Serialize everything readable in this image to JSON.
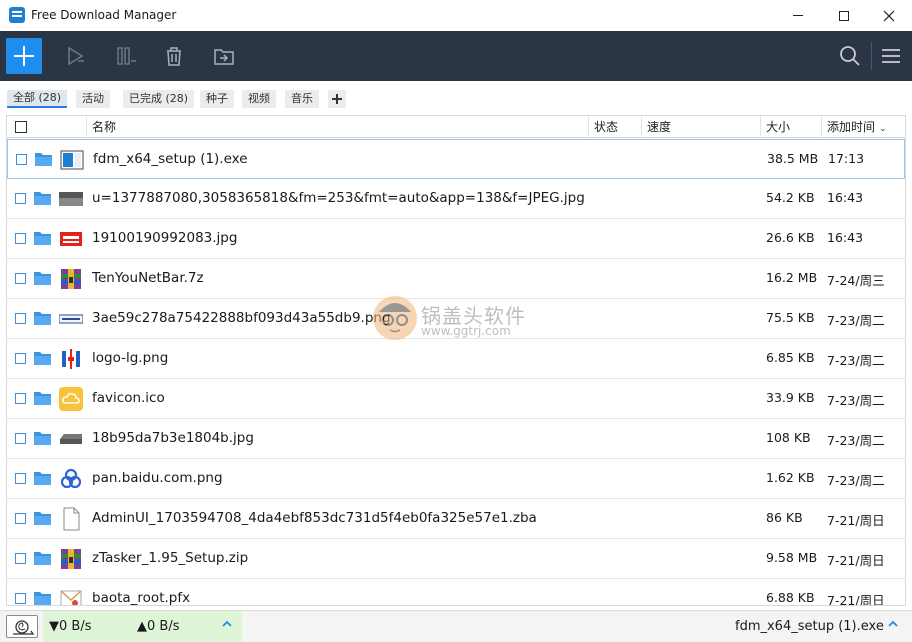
{
  "window": {
    "title": "Free Download Manager"
  },
  "toolbar": {
    "add": "plus-icon",
    "icons": [
      "play-icon",
      "pause-icon",
      "trash-icon",
      "move-folder-icon",
      "search-icon",
      "menu-icon"
    ]
  },
  "filters": [
    {
      "label": "全部 (28)",
      "active": true
    },
    {
      "label": "活动",
      "active": false
    },
    {
      "label": "已完成 (28)",
      "active": false
    },
    {
      "label": "种子",
      "active": false
    },
    {
      "label": "视频",
      "active": false
    },
    {
      "label": "音乐",
      "active": false
    }
  ],
  "columns": {
    "name": "名称",
    "status": "状态",
    "speed": "速度",
    "size": "大小",
    "added": "添加时间",
    "added_sort": "⌄"
  },
  "rows": [
    {
      "name": "fdm_x64_setup (1).exe",
      "size": "38.5 MB",
      "time": "17:13",
      "thumb": "installer-icon"
    },
    {
      "name": "u=1377887080,3058365818&fm=253&fmt=auto&app=138&f=JPEG.jpg",
      "size": "54.2 KB",
      "time": "16:43",
      "thumb": "photo-thumb"
    },
    {
      "name": "19100190992083.jpg",
      "size": "26.6 KB",
      "time": "16:43",
      "thumb": "lenovo-thumb"
    },
    {
      "name": "TenYouNetBar.7z",
      "size": "16.2 MB",
      "time": "7-24/周三",
      "thumb": "archive-icon"
    },
    {
      "name": "3ae59c278a75422888bf093d43a55db9.png",
      "size": "75.5 KB",
      "time": "7-23/周二",
      "thumb": "banner-thumb"
    },
    {
      "name": "logo-lg.png",
      "size": "6.85 KB",
      "time": "7-23/周二",
      "thumb": "logo-thumb"
    },
    {
      "name": "favicon.ico",
      "size": "33.9 KB",
      "time": "7-23/周二",
      "thumb": "cloud-icon"
    },
    {
      "name": "18b95da7b3e1804b.jpg",
      "size": "108 KB",
      "time": "7-23/周二",
      "thumb": "device-thumb"
    },
    {
      "name": "pan.baidu.com.png",
      "size": "1.62 KB",
      "time": "7-23/周二",
      "thumb": "baidu-icon"
    },
    {
      "name": "AdminUI_1703594708_4da4ebf853dc731d5f4eb0fa325e57e1.zba",
      "size": "86 KB",
      "time": "7-21/周日",
      "thumb": "file-icon"
    },
    {
      "name": "zTasker_1.95_Setup.zip",
      "size": "9.58 MB",
      "time": "7-21/周日",
      "thumb": "archive-icon"
    },
    {
      "name": "baota_root.pfx",
      "size": "6.88 KB",
      "time": "7-21/周日",
      "thumb": "certificate-icon"
    }
  ],
  "statusbar": {
    "down": "▼0 B/s",
    "up": "▲0 B/s",
    "file": "fdm_x64_setup (1).exe"
  },
  "watermark": {
    "text": "锅盖头软件",
    "url": "www.ggtrj.com"
  },
  "colors": {
    "accent": "#1e8ff0",
    "toolbar": "#2c3545",
    "speed_bg": "#dff5d7"
  }
}
